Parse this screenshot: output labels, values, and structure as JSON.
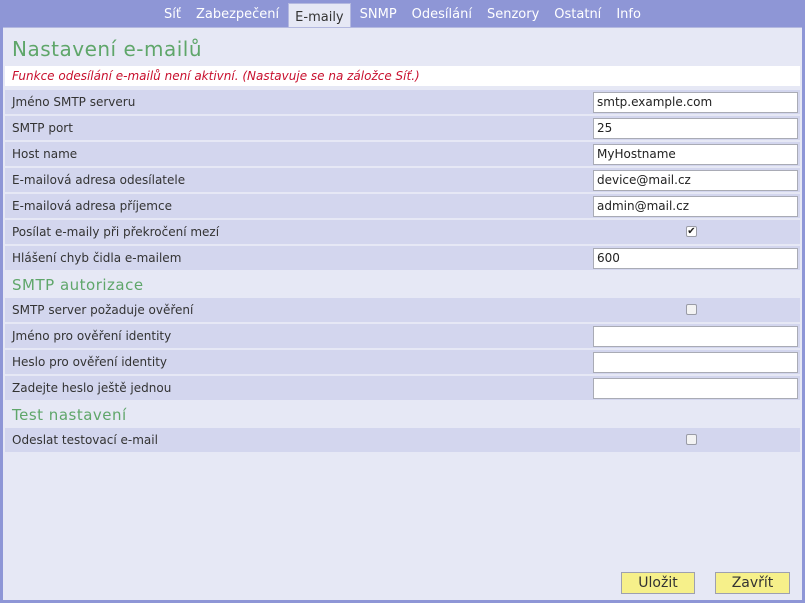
{
  "tabs": [
    {
      "label": "Síť"
    },
    {
      "label": "Zabezpečení"
    },
    {
      "label": "E-maily"
    },
    {
      "label": "SNMP"
    },
    {
      "label": "Odesílání"
    },
    {
      "label": "Senzory"
    },
    {
      "label": "Ostatní"
    },
    {
      "label": "Info"
    }
  ],
  "active_tab": "E-maily",
  "page_title": "Nastavení e-mailů",
  "warning": "Funkce odesílání e-mailů není aktivní. (Nastavuje se na záložce Síť.)",
  "email_settings": {
    "smtp_server": {
      "label": "Jméno SMTP serveru",
      "value": "smtp.example.com"
    },
    "smtp_port": {
      "label": "SMTP port",
      "value": "25"
    },
    "host_name": {
      "label": "Host name",
      "value": "MyHostname"
    },
    "sender": {
      "label": "E-mailová adresa odesílatele",
      "value": "device@mail.cz"
    },
    "recipient": {
      "label": "E-mailová adresa příjemce",
      "value": "admin@mail.cz"
    },
    "send_on_limit": {
      "label": "Posílat e-maily při překročení mezí",
      "checked": true,
      "glyph": "✔"
    },
    "sensor_error": {
      "label": "Hlášení chyb čidla e-mailem",
      "value": "600"
    }
  },
  "smtp_auth": {
    "heading": "SMTP autorizace",
    "requires_auth": {
      "label": "SMTP server požaduje ověření",
      "checked": false
    },
    "username": {
      "label": "Jméno pro ověření identity",
      "value": ""
    },
    "password": {
      "label": "Heslo pro ověření identity",
      "value": ""
    },
    "password_repeat": {
      "label": "Zadejte heslo ještě jednou",
      "value": ""
    }
  },
  "test": {
    "heading": "Test nastavení",
    "send_test": {
      "label": "Odeslat testovací e-mail",
      "checked": false
    }
  },
  "buttons": {
    "save": "Uložit",
    "close": "Zavřít"
  }
}
